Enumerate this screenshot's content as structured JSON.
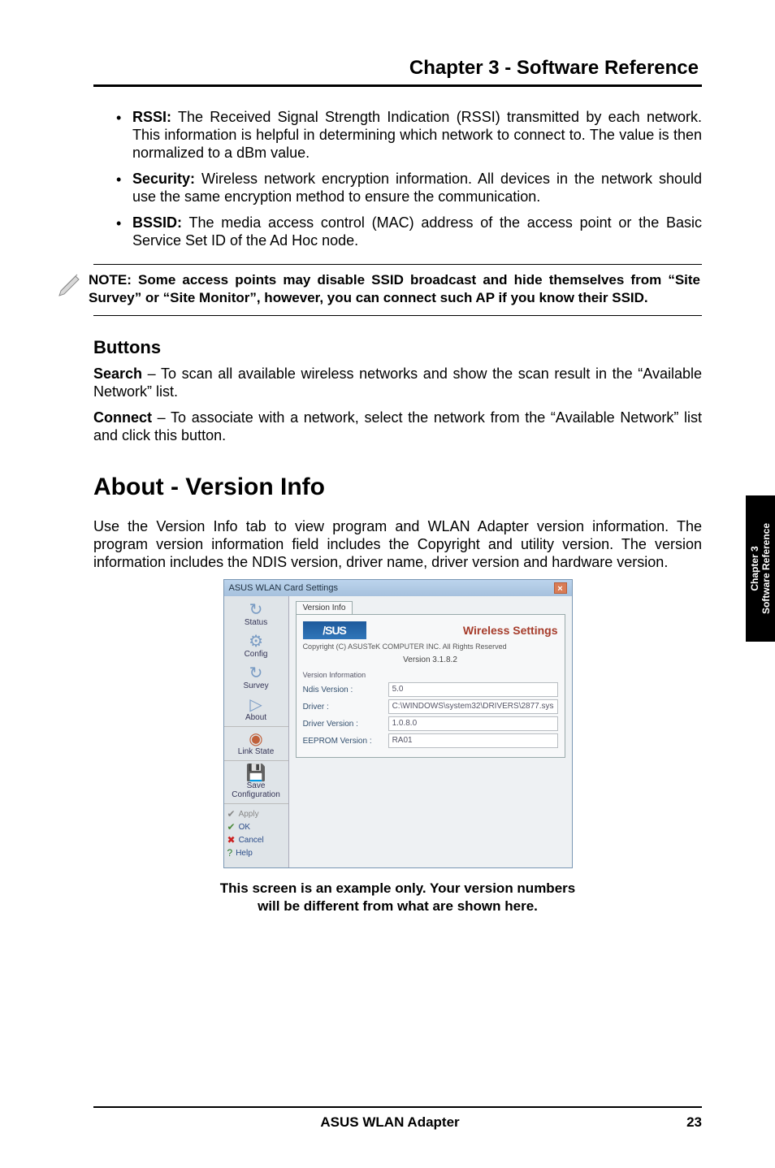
{
  "chapter_title": "Chapter 3 - Software Reference",
  "bullets": {
    "rssi": {
      "label": "RSSI:",
      "text": " The Received Signal Strength Indication (RSSI) transmitted by each network. This information is helpful in determining which network to connect to. The value is then normalized to a dBm value."
    },
    "security": {
      "label": "Security:",
      "text": " Wireless network encryption information. All devices in the network should use the same encryption method to ensure the communication."
    },
    "bssid": {
      "label": "BSSID:",
      "text": " The media access control (MAC) address of the access point or the Basic Service Set ID of the Ad Hoc node."
    }
  },
  "note": "NOTE: Some access points may disable SSID broadcast and hide themselves from “Site Survey” or “Site Monitor”, however, you can connect such AP if you know their SSID.",
  "buttons": {
    "heading": "Buttons",
    "search_label": "Search",
    "search_text": " – To scan all available wireless networks and show the scan result in the “Available Network” list.",
    "connect_label": "Connect",
    "connect_text": " – To associate with a network, select the network from the “Available Network” list and click this button."
  },
  "about": {
    "heading": "About - Version Info",
    "para": "Use the Version Info tab to view program and WLAN Adapter version information. The program version information field includes the Copyright and utility version. The version information includes the NDIS version, driver name, driver version and hardware version."
  },
  "screenshot": {
    "window_title": "ASUS WLAN Card Settings",
    "tab": "Version Info",
    "brand_logo_text": "/SUS",
    "wireless_settings": "Wireless Settings",
    "copyright_line": "Copyright (C) ASUSTeK COMPUTER INC. All Rights Reserved",
    "version_line": "Version 3.1.8.2",
    "version_info_label": "Version Information",
    "rows": {
      "ndis": {
        "k": "Ndis Version :",
        "v": "5.0"
      },
      "driver": {
        "k": "Driver :",
        "v": "C:\\WINDOWS\\system32\\DRIVERS\\2877.sys"
      },
      "driver_ver": {
        "k": "Driver Version :",
        "v": "1.0.8.0"
      },
      "eeprom": {
        "k": "EEPROM Version :",
        "v": "RA01"
      }
    },
    "side": {
      "status": "Status",
      "config": "Config",
      "survey": "Survey",
      "about": "About",
      "link": "Link State",
      "save": "Save Configuration",
      "apply": "Apply",
      "ok": "OK",
      "cancel": "Cancel",
      "help": "Help"
    }
  },
  "caption_line1": "This screen is an example only. Your version numbers",
  "caption_line2": "will be different from what are shown here.",
  "side_tab": {
    "line1": "Chapter 3",
    "line2": "Software Reference"
  },
  "footer": {
    "center": "ASUS WLAN Adapter",
    "page": "23"
  }
}
